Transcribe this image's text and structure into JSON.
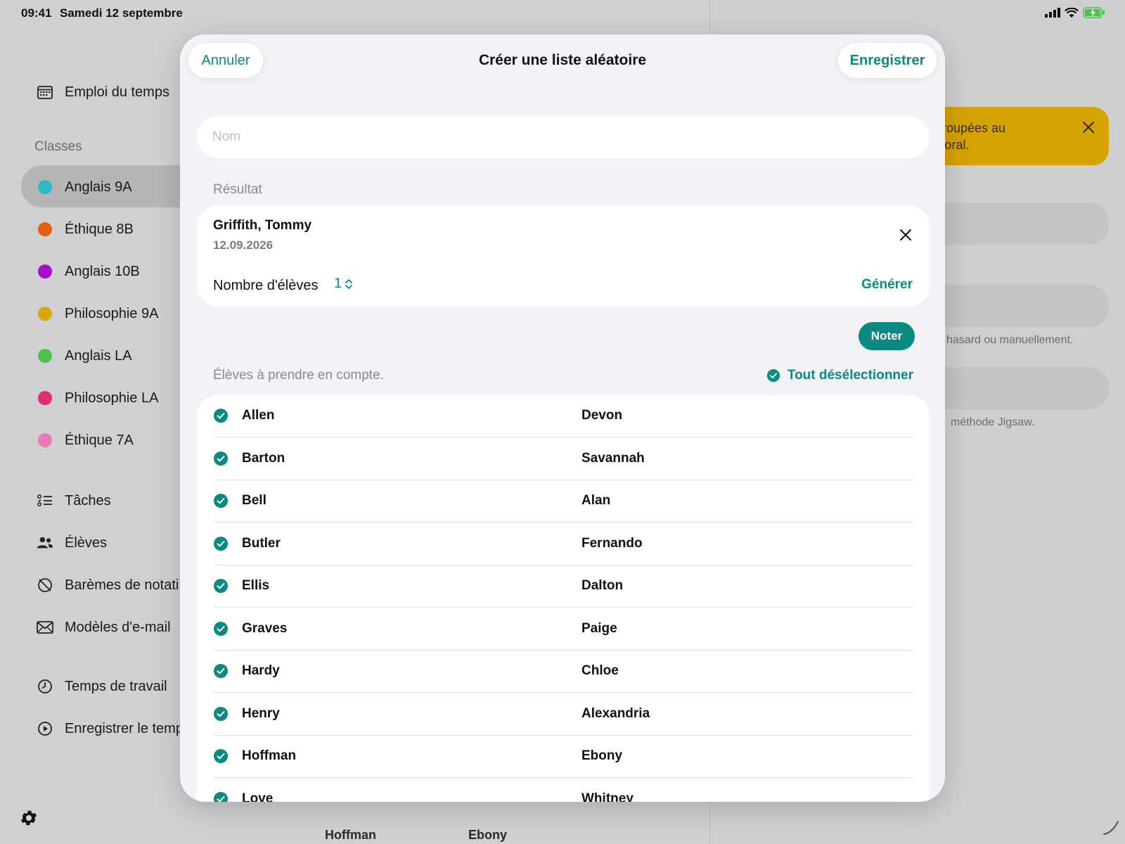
{
  "status": {
    "time": "09:41",
    "date": "Samedi 12 septembre"
  },
  "sidebar": {
    "schedule_label": "Emploi du temps",
    "classes_title": "Classes",
    "classes": [
      {
        "label": "Anglais 9A",
        "color": "#2eb8c2"
      },
      {
        "label": "Éthique 8B",
        "color": "#e0600f"
      },
      {
        "label": "Anglais 10B",
        "color": "#a410c8"
      },
      {
        "label": "Philosophie 9A",
        "color": "#d9a70c"
      },
      {
        "label": "Anglais LA",
        "color": "#4cc24c"
      },
      {
        "label": "Philosophie LA",
        "color": "#e02a7a"
      },
      {
        "label": "Éthique 7A",
        "color": "#e97ab8"
      }
    ],
    "tools": [
      {
        "label": "Tâches",
        "icon": "tasks-icon"
      },
      {
        "label": "Élèves",
        "icon": "students-icon"
      },
      {
        "label": "Barèmes de notati",
        "icon": "grading-scale-icon"
      },
      {
        "label": "Modèles d'e-mail",
        "icon": "envelope-icon"
      }
    ],
    "time_items": [
      {
        "label": "Temps de travail",
        "icon": "clock-icon"
      },
      {
        "label": "Enregistrer le temp",
        "icon": "play-circle-icon"
      }
    ]
  },
  "background": {
    "banner_text_line1": "roupées au",
    "banner_text_line2": "'oral.",
    "note1": "hasard ou manuellement.",
    "note2": "méthode Jigsaw.",
    "bottom_last": "Hoffman",
    "bottom_first": "Ebony"
  },
  "modal": {
    "cancel_label": "Annuler",
    "title": "Créer une liste aléatoire",
    "save_label": "Enregistrer",
    "name_placeholder": "Nom",
    "result_section": "Résultat",
    "result": {
      "name": "Griffith, Tommy",
      "date": "12.09.2026",
      "count_label": "Nombre d'élèves",
      "count_value": "1",
      "generate_label": "Générer"
    },
    "noter_label": "Noter",
    "students_section": "Élèves à prendre en compte.",
    "deselect_label": "Tout désélectionner",
    "students": [
      {
        "last": "Allen",
        "first": "Devon"
      },
      {
        "last": "Barton",
        "first": "Savannah"
      },
      {
        "last": "Bell",
        "first": "Alan"
      },
      {
        "last": "Butler",
        "first": "Fernando"
      },
      {
        "last": "Ellis",
        "first": "Dalton"
      },
      {
        "last": "Graves",
        "first": "Paige"
      },
      {
        "last": "Hardy",
        "first": "Chloe"
      },
      {
        "last": "Henry",
        "first": "Alexandria"
      },
      {
        "last": "Hoffman",
        "first": "Ebony"
      },
      {
        "last": "Love",
        "first": "Whitney"
      }
    ]
  },
  "colors": {
    "accent": "#0a8a80",
    "banner": "#d6a305"
  }
}
